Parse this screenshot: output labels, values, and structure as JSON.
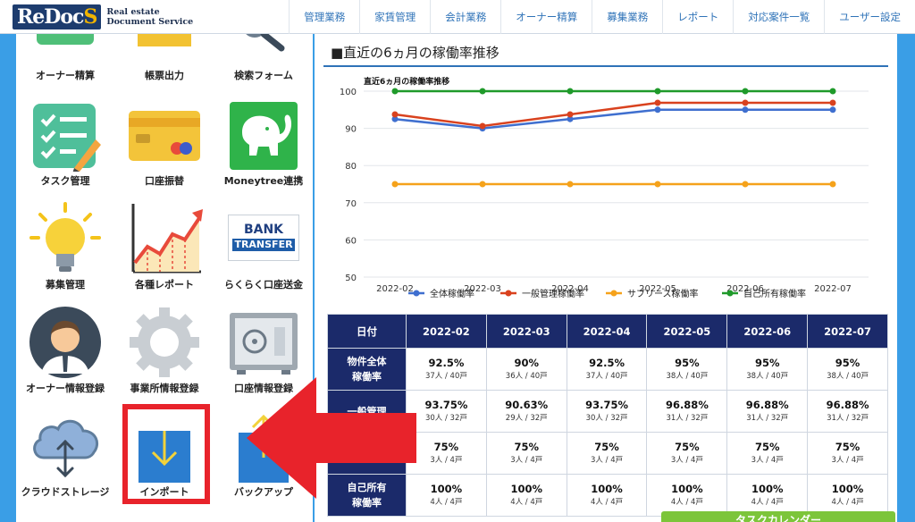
{
  "header": {
    "logo_mark_re": "Re",
    "logo_mark_doc": "Doc",
    "logo_mark_s": "S",
    "logo_line1": "Real estate",
    "logo_line2": "Document Service",
    "nav": [
      "管理業務",
      "家賃管理",
      "会計業務",
      "オーナー精算",
      "募集業務",
      "レポート",
      "対応案件一覧",
      "ユーザー設定"
    ]
  },
  "tiles": {
    "owner_settlement": "オーナー精算",
    "form_output": "帳票出力",
    "search_form": "検索フォーム",
    "task_management": "タスク管理",
    "account_transfer": "口座振替",
    "moneytree": "Moneytree連携",
    "recruitment": "募集管理",
    "reports": "各種レポート",
    "bank_transfer": "らくらく口座送金",
    "bank_logo_1": "BANK",
    "bank_logo_2": "TRANSFER",
    "owner_info": "オーナー情報登録",
    "office_info": "事業所情報登録",
    "account_info": "口座情報登録",
    "cloud_storage": "クラウドストレージ",
    "import": "インポート",
    "backup": "バックアップ"
  },
  "section": {
    "title": "■直近の6ヵ月の稼働率推移"
  },
  "chart_data": {
    "type": "line",
    "title": "直近6ヵ月の稼働率推移",
    "x": [
      "2022-02",
      "2022-03",
      "2022-04",
      "2022-05",
      "2022-06",
      "2022-07"
    ],
    "ylim": [
      50,
      100
    ],
    "yticks": [
      50,
      60,
      70,
      80,
      90,
      100
    ],
    "grid": true,
    "legend": "bottom",
    "series": [
      {
        "name": "全体稼働率",
        "color": "#3f6fcf",
        "values": [
          92.5,
          90,
          92.5,
          95,
          95,
          95
        ]
      },
      {
        "name": "一般管理稼働率",
        "color": "#d9421e",
        "values": [
          93.75,
          90.63,
          93.75,
          96.88,
          96.88,
          96.88
        ]
      },
      {
        "name": "サブリース稼働率",
        "color": "#f5a21b",
        "values": [
          75,
          75,
          75,
          75,
          75,
          75
        ]
      },
      {
        "name": "自己所有稼働率",
        "color": "#1f9a2a",
        "values": [
          100,
          100,
          100,
          100,
          100,
          100
        ]
      }
    ]
  },
  "table": {
    "header_date": "日付",
    "months": [
      "2022-02",
      "2022-03",
      "2022-04",
      "2022-05",
      "2022-06",
      "2022-07"
    ],
    "rows": [
      {
        "label1": "物件全体",
        "label2": "稼働率",
        "cells": [
          [
            "92.5%",
            "37人 / 40戸"
          ],
          [
            "90%",
            "36人 / 40戸"
          ],
          [
            "92.5%",
            "37人 / 40戸"
          ],
          [
            "95%",
            "38人 / 40戸"
          ],
          [
            "95%",
            "38人 / 40戸"
          ],
          [
            "95%",
            "38人 / 40戸"
          ]
        ]
      },
      {
        "label1": "一般管理",
        "label2": "",
        "cells": [
          [
            "93.75%",
            "30人 / 32戸"
          ],
          [
            "90.63%",
            "29人 / 32戸"
          ],
          [
            "93.75%",
            "30人 / 32戸"
          ],
          [
            "96.88%",
            "31人 / 32戸"
          ],
          [
            "96.88%",
            "31人 / 32戸"
          ],
          [
            "96.88%",
            "31人 / 32戸"
          ]
        ]
      },
      {
        "label1": "",
        "label2": "",
        "cells": [
          [
            "75%",
            "3人 / 4戸"
          ],
          [
            "75%",
            "3人 / 4戸"
          ],
          [
            "75%",
            "3人 / 4戸"
          ],
          [
            "75%",
            "3人 / 4戸"
          ],
          [
            "75%",
            "3人 / 4戸"
          ],
          [
            "75%",
            "3人 / 4戸"
          ]
        ]
      },
      {
        "label1": "自己所有",
        "label2": "稼働率",
        "cells": [
          [
            "100%",
            "4人 / 4戸"
          ],
          [
            "100%",
            "4人 / 4戸"
          ],
          [
            "100%",
            "4人 / 4戸"
          ],
          [
            "100%",
            "4人 / 4戸"
          ],
          [
            "100%",
            "4人 / 4戸"
          ],
          [
            "100%",
            "4人 / 4戸"
          ]
        ]
      }
    ]
  },
  "green_button": "タスクカレンダー",
  "colors": {
    "nav_text": "#2f73b8",
    "table_header": "#1b2a6a",
    "highlight": "#e8232b",
    "background": "#3a9ee6"
  }
}
